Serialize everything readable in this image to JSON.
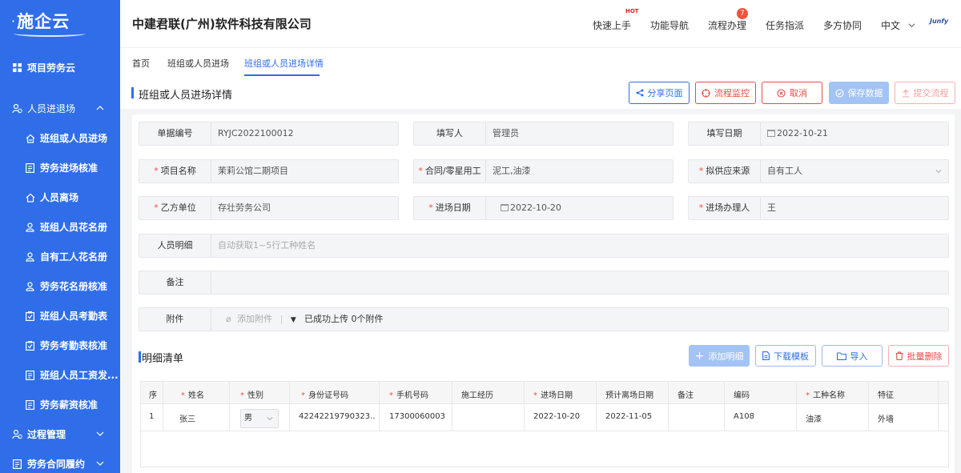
{
  "app": {
    "logo_text": "施企云",
    "company": "中建君联(广州)软件科技有限公司"
  },
  "sidebar": {
    "items": [
      {
        "label": "项目劳务云",
        "icon": "grid-icon"
      },
      {
        "label": "人员进退场",
        "icon": "users-icon",
        "expanded": true
      },
      {
        "label": "班组或人员进场",
        "icon": "home-enter-icon"
      },
      {
        "label": "劳务进场核准",
        "icon": "doc-list-icon"
      },
      {
        "label": "人员离场",
        "icon": "home-exit-icon"
      },
      {
        "label": "班组人员花名册",
        "icon": "user-group-icon"
      },
      {
        "label": "自有工人花名册",
        "icon": "user-group-icon"
      },
      {
        "label": "劳务花名册核准",
        "icon": "user-group-icon"
      },
      {
        "label": "班组人员考勤表",
        "icon": "clipboard-check-icon"
      },
      {
        "label": "劳务考勤表核准",
        "icon": "clipboard-check-icon"
      },
      {
        "label": "班组人员工资发...",
        "icon": "doc-list-icon"
      },
      {
        "label": "劳务薪资核准",
        "icon": "doc-list-icon"
      },
      {
        "label": "过程管理",
        "icon": "users-icon",
        "expanded": false
      },
      {
        "label": "劳务合同履约",
        "icon": "doc-list-icon",
        "expanded": false
      }
    ]
  },
  "header": {
    "nav": [
      "快速上手",
      "功能导航",
      "流程办理",
      "任务指派",
      "多方协同",
      "中文"
    ],
    "hot_label": "HOT",
    "flow_badge": "7",
    "user_logo": "Junfy"
  },
  "tabs": [
    "首页",
    "班组或人员进场",
    "班组或人员进场详情"
  ],
  "page": {
    "title": "班组或人员进场详情"
  },
  "toolbar": {
    "share": "分享页面",
    "monitor": "流程监控",
    "cancel": "取消",
    "save": "保存数据",
    "submit": "提交流程"
  },
  "form": {
    "doc_no_label": "单据编号",
    "doc_no": "RYJC2022100012",
    "writer_label": "填写人",
    "writer": "管理员",
    "fill_date_label": "填写日期",
    "fill_date": "2022-10-21",
    "project_label": "项目名称",
    "project": "茉莉公馆二期项目",
    "contract_label": "合同/零星用工",
    "contract": "泥工,油漆",
    "supplier_label": "拟供应来源",
    "supplier": "自有工人",
    "partyb_label": "乙方单位",
    "partyb": "存壮劳务公司",
    "entry_date_label": "进场日期",
    "entry_date": "2022-10-20",
    "handler_label": "进场办理人",
    "handler": "王",
    "detail_label": "人员明细",
    "detail_placeholder": "自动获取1~5行工种姓名",
    "remark_label": "备注",
    "remark": "",
    "attach_label": "附件",
    "attach_add": "添加附件",
    "attach_status": "已成功上传 0个附件"
  },
  "detail_list": {
    "title": "明细清单",
    "add": "添加明细",
    "download": "下载模板",
    "import": "导入",
    "batch_delete": "批量删除",
    "columns": [
      "序",
      "姓名",
      "性别",
      "身份证号码",
      "手机号码",
      "施工经历",
      "进场日期",
      "预计离场日期",
      "备注",
      "编码",
      "工种名称",
      "特征"
    ],
    "rows": [
      [
        "1",
        "张三",
        "男",
        "42242219790323...",
        "17300060003",
        "",
        "2022-10-20",
        "2022-11-05",
        "",
        "A108",
        "油漆",
        "外墙"
      ]
    ]
  },
  "colors": {
    "primary": "#2f6ee8",
    "danger": "#e84a4a",
    "badge": "#f0533b"
  }
}
